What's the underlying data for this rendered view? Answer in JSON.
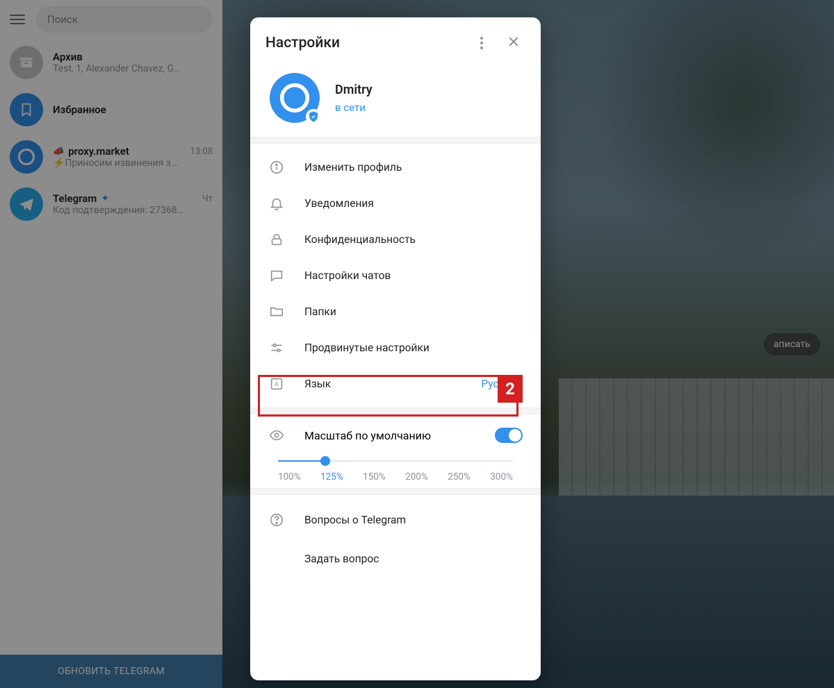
{
  "sidebar": {
    "search_placeholder": "Поиск",
    "archive": {
      "title": "Архив",
      "sub": "Test, 1, Alexander Chavez, G…"
    },
    "favorites": {
      "title": "Избранное"
    },
    "chats": [
      {
        "title": "proxy.market",
        "time": "13:08",
        "sub": "Приносим извинения з…"
      },
      {
        "title": "Telegram",
        "time": "Чт",
        "sub": "Код подтверждения: 27368…"
      }
    ],
    "update_btn": "ОБНОВИТЬ TELEGRAM"
  },
  "bg_button": "аписать",
  "modal": {
    "title": "Настройки",
    "profile": {
      "name": "Dmitry",
      "status": "в сети"
    },
    "menu": [
      {
        "label": "Изменить профиль"
      },
      {
        "label": "Уведомления"
      },
      {
        "label": "Конфиденциальность"
      },
      {
        "label": "Настройки чатов"
      },
      {
        "label": "Папки"
      },
      {
        "label": "Продвинутые настройки"
      },
      {
        "label": "Язык",
        "value": "Русский"
      }
    ],
    "scale": {
      "label": "Масштаб по умолчанию",
      "options": [
        "100%",
        "125%",
        "150%",
        "200%",
        "250%",
        "300%"
      ],
      "active_index": 1
    },
    "bottom": [
      {
        "label": "Вопросы о Telegram"
      },
      {
        "label": "Задать вопрос"
      }
    ]
  },
  "annotation": {
    "number": "2"
  }
}
